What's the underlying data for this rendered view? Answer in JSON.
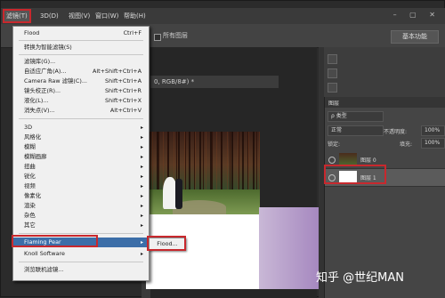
{
  "menubar": {
    "items": [
      "滤镜(T)",
      "3D(D)",
      "视图(V)",
      "窗口(W)",
      "帮助(H)"
    ],
    "window_controls": "– ▢ ✕"
  },
  "options_bar": {
    "all_layers_label": "所有图层",
    "workspace_button": "基本功能"
  },
  "document": {
    "tab_title": "0, RGB/8#) *"
  },
  "filter_menu": {
    "items": [
      {
        "label": "Flood",
        "shortcut": "Ctrl+F"
      },
      {
        "label": "转换为智能滤镜(S)"
      },
      {
        "label": "滤镜库(G)..."
      },
      {
        "label": "自适应广角(A)...",
        "shortcut": "Alt+Shift+Ctrl+A"
      },
      {
        "label": "Camera Raw 滤镜(C)...",
        "shortcut": "Shift+Ctrl+A"
      },
      {
        "label": "镜头校正(R)...",
        "shortcut": "Shift+Ctrl+R"
      },
      {
        "label": "液化(L)...",
        "shortcut": "Shift+Ctrl+X"
      },
      {
        "label": "消失点(V)...",
        "shortcut": "Alt+Ctrl+V"
      },
      {
        "label": "3D"
      },
      {
        "label": "风格化"
      },
      {
        "label": "模糊"
      },
      {
        "label": "模糊画廊"
      },
      {
        "label": "扭曲"
      },
      {
        "label": "锐化"
      },
      {
        "label": "视频"
      },
      {
        "label": "像素化"
      },
      {
        "label": "渲染"
      },
      {
        "label": "杂色"
      },
      {
        "label": "其它"
      },
      {
        "label": "Flaming Pear"
      },
      {
        "label": "Knoll Software"
      },
      {
        "label": "浏览联机滤镜..."
      }
    ]
  },
  "submenu": {
    "item": "Flood..."
  },
  "layers_panel": {
    "title": "图层",
    "filter_kind": "ρ 类型",
    "blend_mode": "正常",
    "opacity_label": "不透明度:",
    "opacity_value": "100%",
    "lock_label": "锁定:",
    "fill_label": "填充:",
    "fill_value": "100%",
    "layers": [
      {
        "name": "图层 0",
        "selected": false
      },
      {
        "name": "图层 1",
        "selected": true
      }
    ]
  },
  "watermark": "知乎 @世纪MAN",
  "colors": {
    "highlight": "#c8282d",
    "menu_hover": "#3c6ea8"
  }
}
